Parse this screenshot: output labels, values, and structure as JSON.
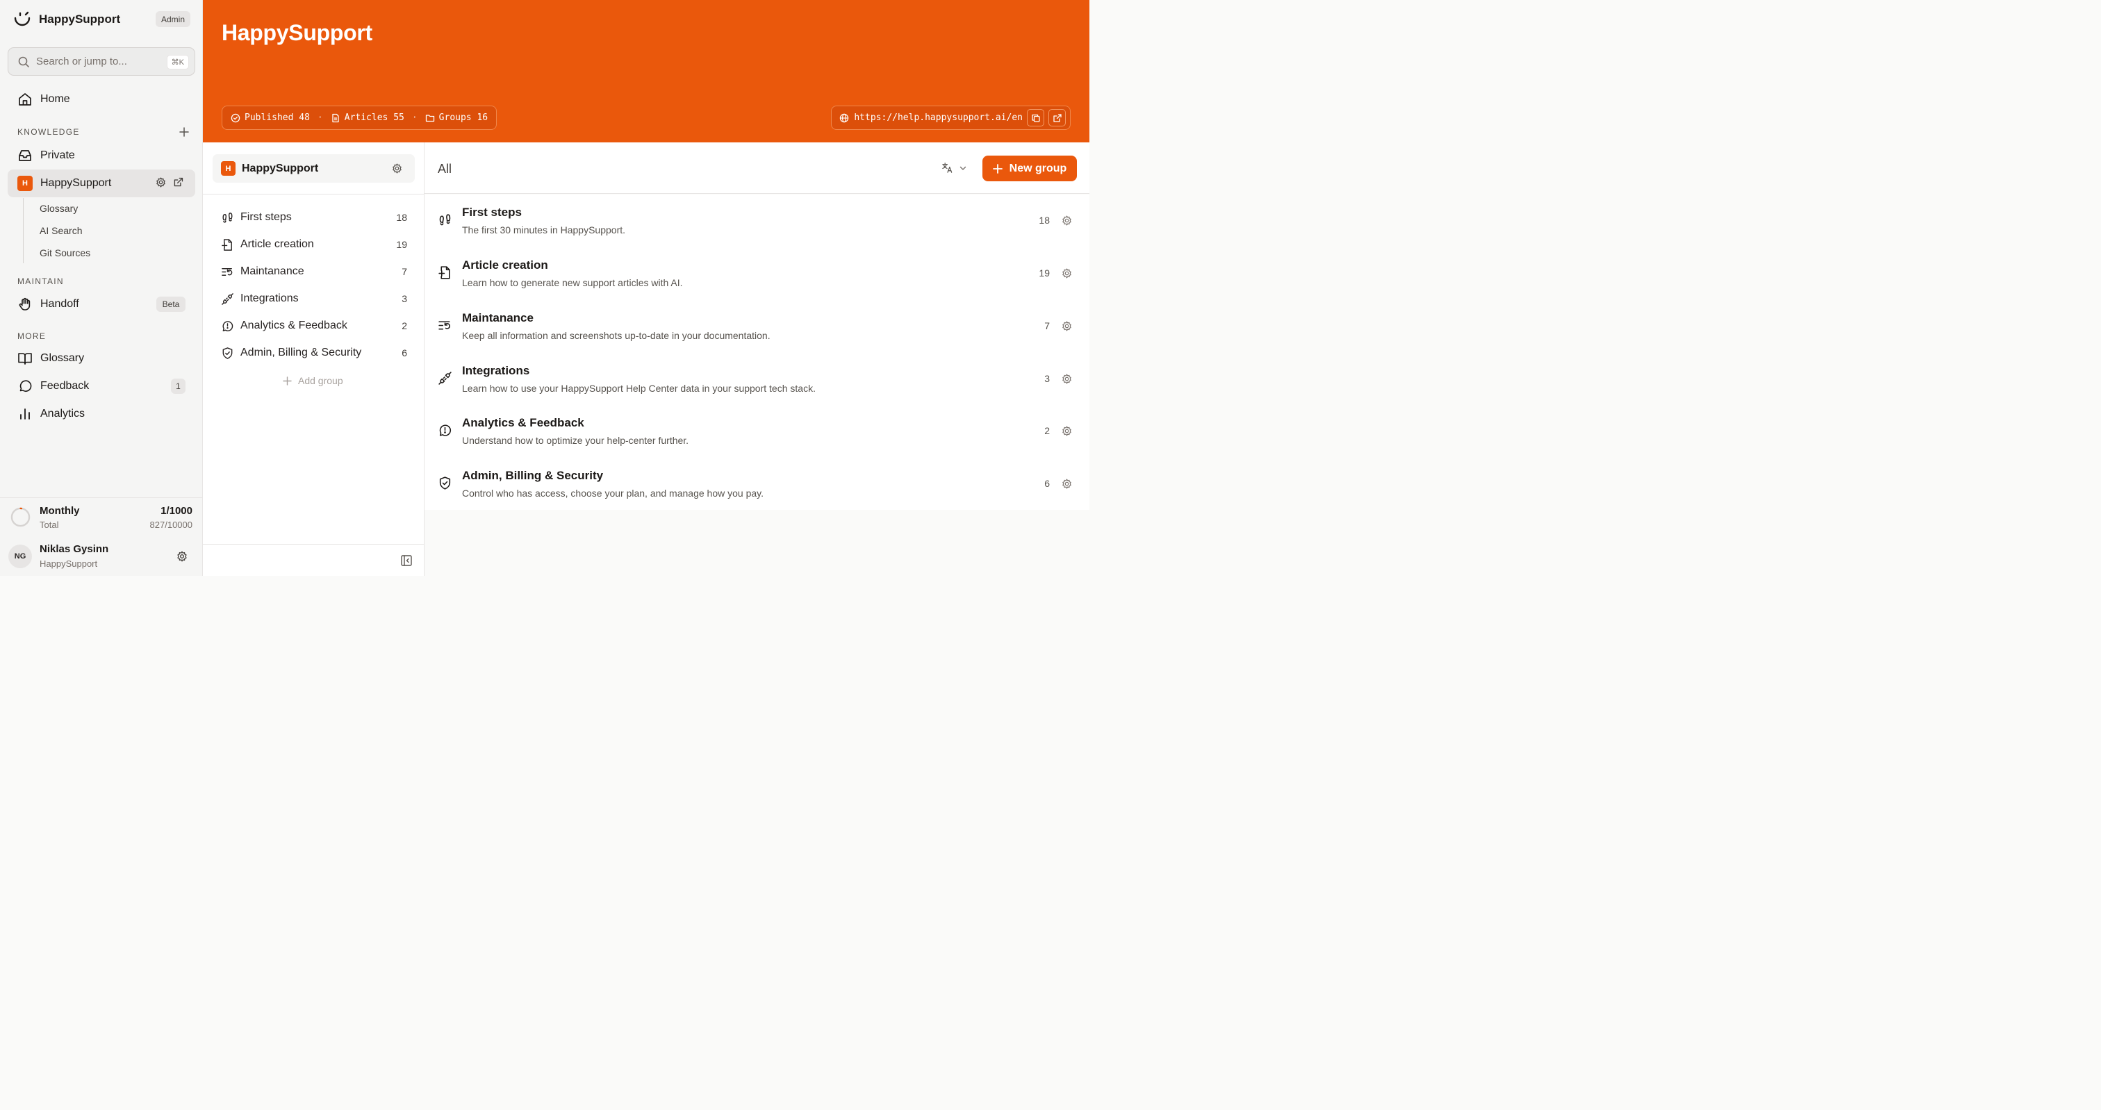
{
  "app": {
    "name": "HappySupport",
    "role_badge": "Admin"
  },
  "search": {
    "placeholder": "Search or jump to...",
    "shortcut": "⌘K"
  },
  "sidebar": {
    "home_label": "Home",
    "knowledge_heading": "KNOWLEDGE",
    "private_label": "Private",
    "kb": {
      "initial": "H",
      "name": "HappySupport"
    },
    "kb_sub": [
      "Glossary",
      "AI Search",
      "Git Sources"
    ],
    "maintain_heading": "MAINTAIN",
    "handoff_label": "Handoff",
    "handoff_badge": "Beta",
    "more_heading": "MORE",
    "glossary_label": "Glossary",
    "feedback_label": "Feedback",
    "feedback_count": "1",
    "analytics_label": "Analytics"
  },
  "usage": {
    "title": "Monthly",
    "subtitle": "Total",
    "count": "1/1000",
    "total": "827/10000",
    "fraction": 0.001
  },
  "user": {
    "initials": "NG",
    "name": "Niklas Gysinn",
    "org": "HappySupport"
  },
  "header": {
    "title": "HappySupport",
    "stats": [
      {
        "label": "Published 48",
        "icon": "check-circle-icon"
      },
      {
        "label": "Articles 55",
        "icon": "file-icon"
      },
      {
        "label": "Groups 16",
        "icon": "folder-icon"
      }
    ],
    "url": "https://help.happysupport.ai/en"
  },
  "kb_panel": {
    "initial": "H",
    "name": "HappySupport",
    "add_group_label": "Add group"
  },
  "main": {
    "title": "All",
    "new_group_label": "New group"
  },
  "groups": [
    {
      "name": "First steps",
      "count": "18",
      "description": "The first 30 minutes in HappySupport.",
      "icon": "footprints-icon"
    },
    {
      "name": "Article creation",
      "count": "19",
      "description": "Learn how to generate new support articles with AI.",
      "icon": "file-plus-icon"
    },
    {
      "name": "Maintanance",
      "count": "7",
      "description": "Keep all information and screenshots up-to-date in your documentation.",
      "icon": "list-restart-icon"
    },
    {
      "name": "Integrations",
      "count": "3",
      "description": "Learn how to use your HappySupport Help Center data in your support tech stack.",
      "icon": "plug-icon"
    },
    {
      "name": "Analytics & Feedback",
      "count": "2",
      "description": "Understand how to optimize your help-center further.",
      "icon": "message-alert-icon"
    },
    {
      "name": "Admin, Billing & Security",
      "count": "6",
      "description": "Control who has access, choose your plan, and manage how you pay.",
      "icon": "shield-check-icon"
    }
  ],
  "colors": {
    "brand": "#ea580c",
    "sidebar_bg": "#f5f5f4"
  }
}
